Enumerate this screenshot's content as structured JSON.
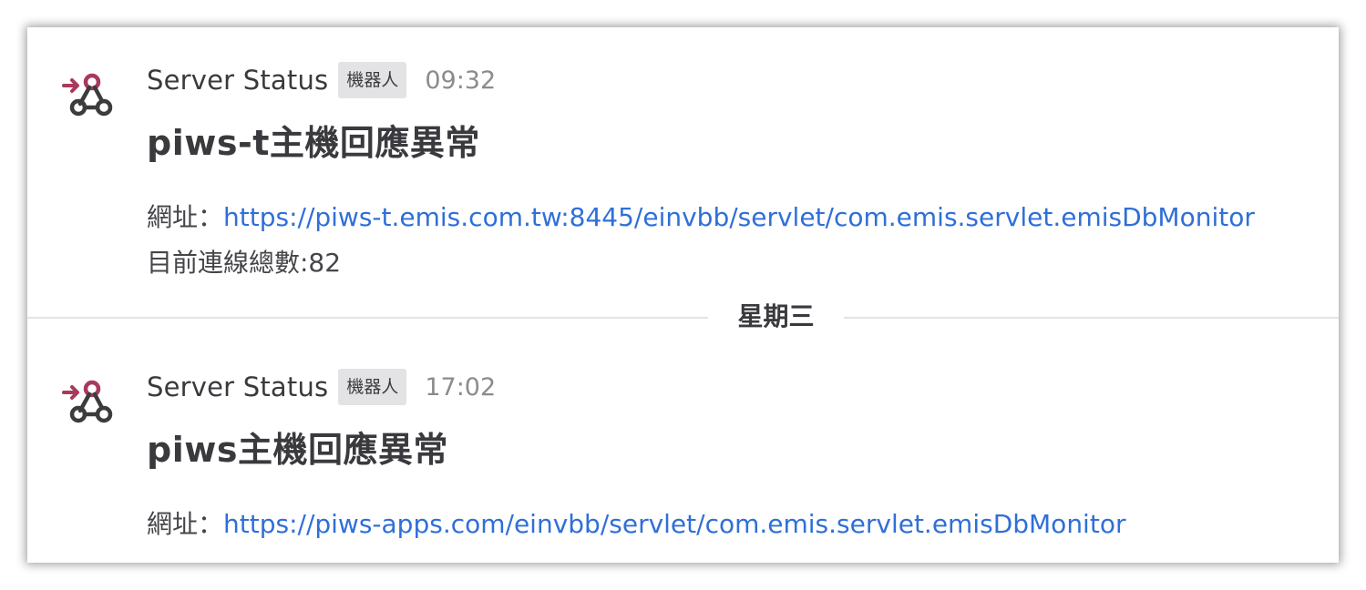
{
  "messages": [
    {
      "sender": "Server Status",
      "badge": "機器人",
      "time": "09:32",
      "title": "piws-t主機回應異常",
      "url_label": "網址：",
      "url": "https://piws-t.emis.com.tw:8445/einvbb/servlet/com.emis.servlet.emisDbMonitor",
      "extra": "目前連線總數:82"
    },
    {
      "sender": "Server Status",
      "badge": "機器人",
      "time": "17:02",
      "title": "piws主機回應異常",
      "url_label": "網址：",
      "url": "https://piws-apps.com/einvbb/servlet/com.emis.servlet.emisDbMonitor"
    }
  ],
  "day_divider": "星期三",
  "colors": {
    "link": "#2f6fd8",
    "text": "#3a3a3e",
    "timestamp": "#8b8b8f",
    "badge_bg": "#e3e3e5",
    "icon_accent": "#a83a5c",
    "icon_dark": "#3c3c3c"
  },
  "icons": {
    "avatar": "webhook-icon"
  }
}
